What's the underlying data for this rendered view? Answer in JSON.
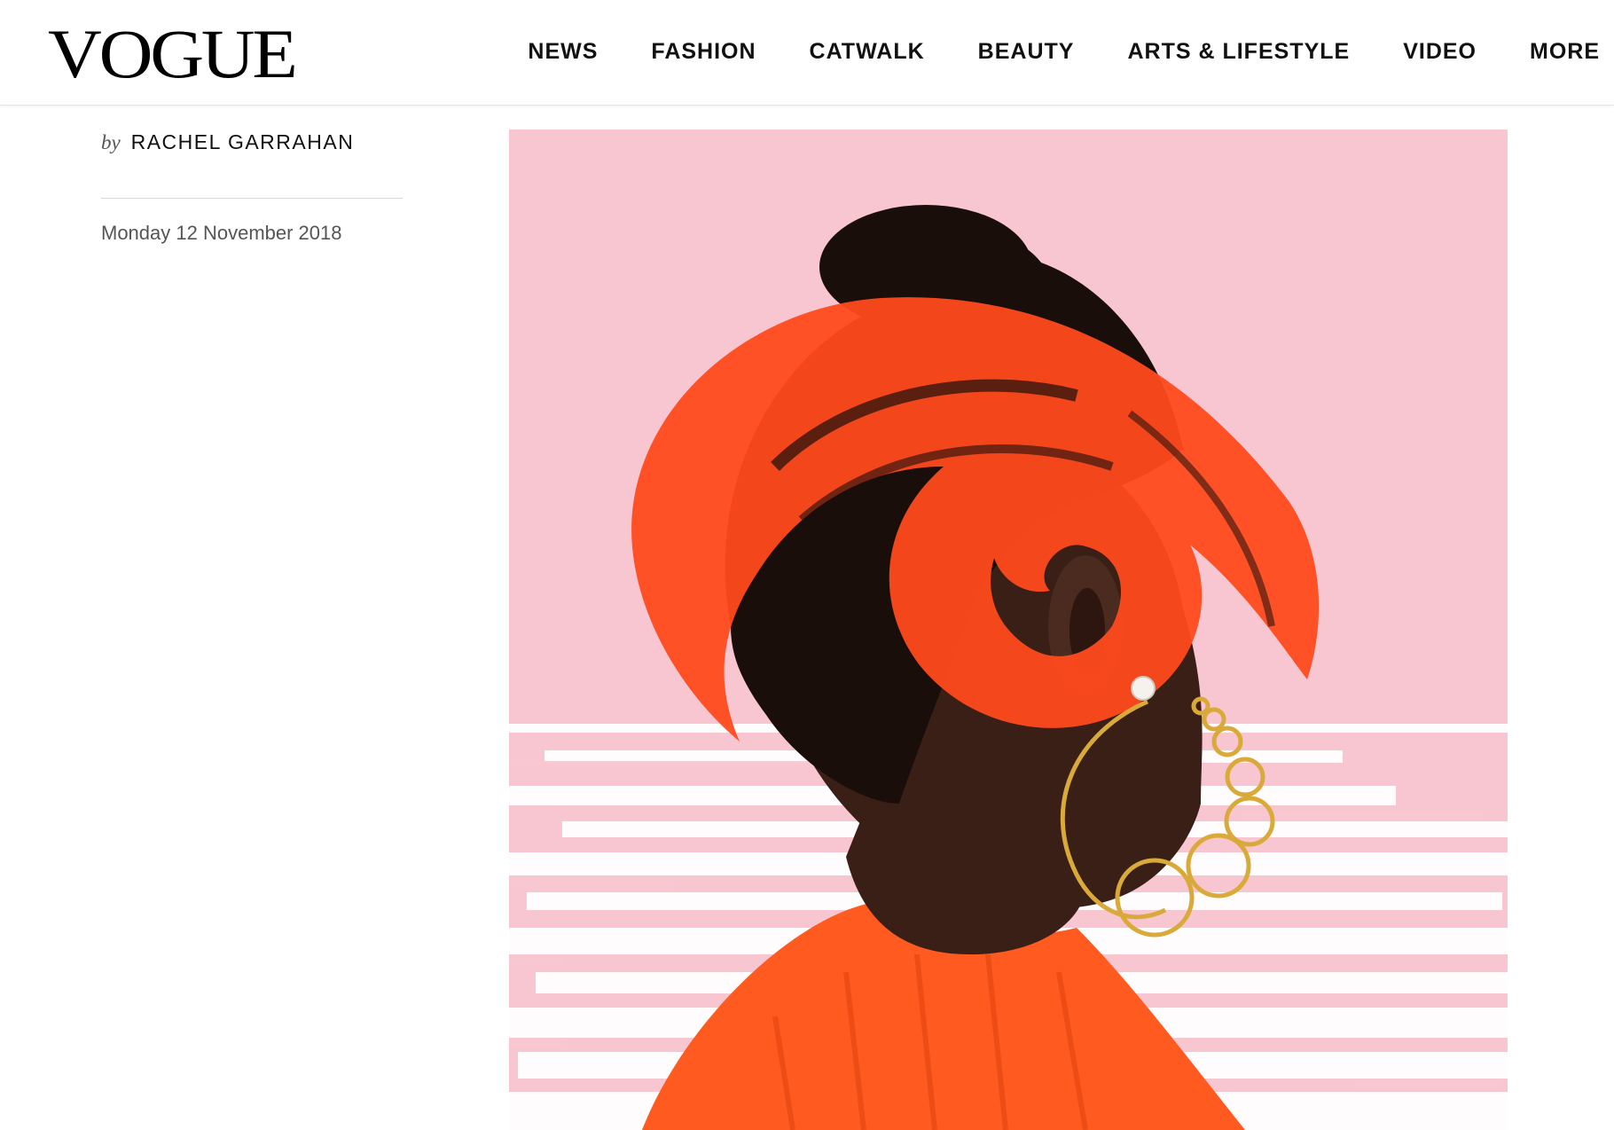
{
  "header": {
    "logo": "VOGUE",
    "nav": [
      "NEWS",
      "FASHION",
      "CATWALK",
      "BEAUTY",
      "ARTS & LIFESTYLE",
      "VIDEO",
      "MORE"
    ]
  },
  "article": {
    "by_prefix": "by",
    "author": "RACHEL GARRAHAN",
    "date": "Monday 12 November 2018"
  },
  "hero_image": {
    "icon": "portrait-illustration",
    "colors": {
      "background": "#f7c6d1",
      "paint": "#ff4a1c",
      "sweater": "#ff5a1f",
      "skin": "#3a1f16",
      "hair": "#1a0e0b",
      "earring": "#d9a93a"
    }
  }
}
